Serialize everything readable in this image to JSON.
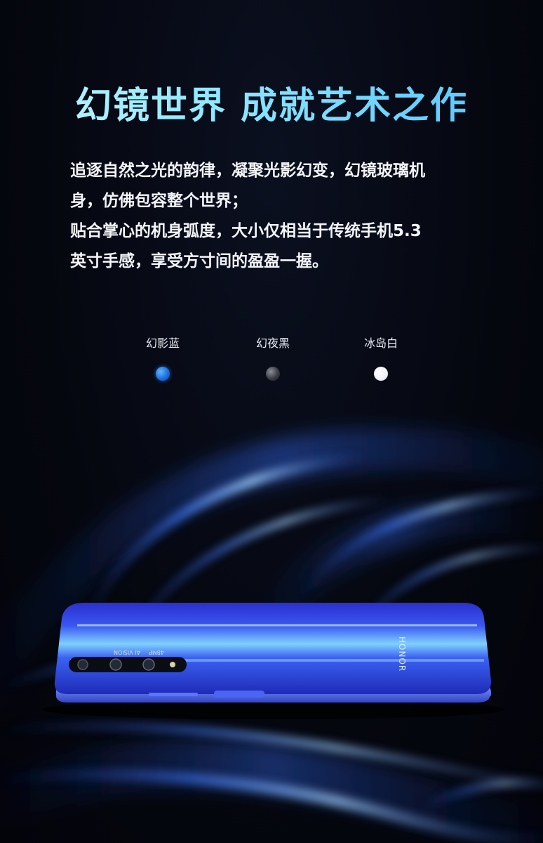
{
  "headline": "幻镜世界  成就艺术之作",
  "description": {
    "line1": "追逐自然之光的韵律，凝聚光影幻变，幻镜玻璃机",
    "line2": "身，仿佛包容整个世界；",
    "line3": "贴合掌心的机身弧度，大小仅相当于传统手机5.3",
    "line4": "英寸手感，享受方寸间的盈盈一握。"
  },
  "colors": [
    {
      "label": "幻影蓝",
      "swatch": "#1f6fe0"
    },
    {
      "label": "幻夜黑",
      "swatch": "#3a3d44"
    },
    {
      "label": "冰岛白",
      "swatch": "#eef1f8"
    }
  ],
  "phone": {
    "brand": "HONOR",
    "camera_text_1": "48MP",
    "camera_text_2": "AI VISION"
  }
}
